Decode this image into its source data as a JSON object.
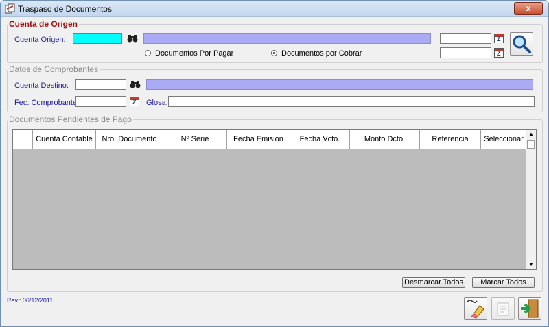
{
  "window": {
    "title": "Traspaso de Documentos",
    "close_label": "x"
  },
  "origen": {
    "legend": "Cuenta de Origen",
    "account_label": "Cuenta Origen:",
    "account_value": "",
    "account_description": "",
    "date_from": "",
    "date_to": "",
    "radio_pagar": "Documentos Por Pagar",
    "radio_cobrar": "Documentos por Cobrar",
    "selected_radio": "cobrar"
  },
  "comprobantes": {
    "legend": "Datos de Comprobantes",
    "destino_label": "Cuenta Destino:",
    "destino_value": "",
    "destino_description": "",
    "fecha_label": "Fec. Comprobante:",
    "fecha_value": "",
    "glosa_label": "Glosa:",
    "glosa_value": ""
  },
  "pendientes": {
    "legend": "Documentos Pendientes de Pago",
    "columns": [
      "",
      "Cuenta Contable",
      "Nro. Documento",
      "Nº Serie",
      "Fecha Emision",
      "Fecha Vcto.",
      "Monto Dcto.",
      "Referencia",
      "Seleccionar"
    ],
    "rows": [],
    "desmarcar_label": "Desmarcar Todos",
    "marcar_label": "Marcar Todos"
  },
  "footer": {
    "revision": "Rev.: 06/12/2011"
  },
  "colors": {
    "accent_cyan": "#00ffff",
    "readonly_purple": "#aaaaf5",
    "legend_red": "#a01010",
    "label_blue": "#1a1aa6"
  },
  "icons": [
    "binoculars-icon",
    "calendar-icon",
    "magnifier-icon",
    "eraser-icon",
    "print-icon",
    "exit-door-icon"
  ]
}
